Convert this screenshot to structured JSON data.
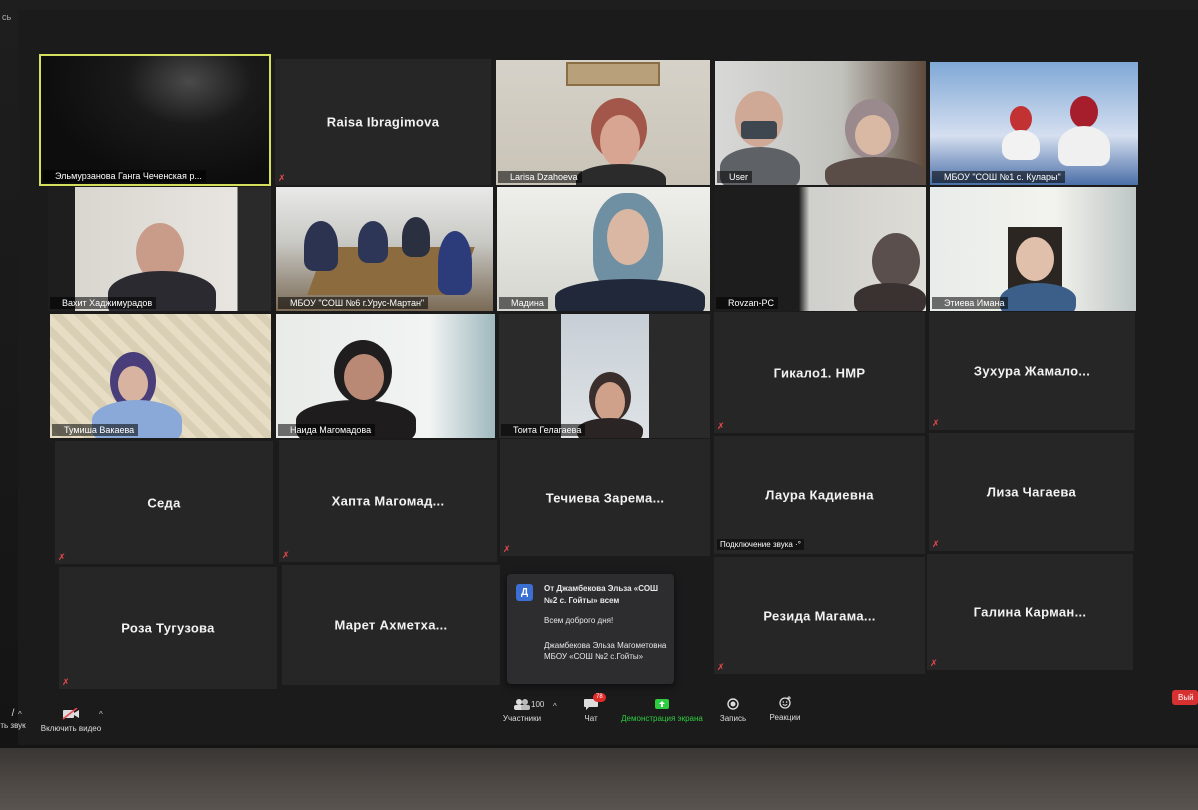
{
  "top_glyph": "сь",
  "tiles": [
    {
      "label": "Эльмурзанова Ганга Чеченская р...",
      "type": "video"
    },
    {
      "name": "Raisa Ibragimova",
      "type": "name"
    },
    {
      "label": "Larisa Dzahoeva",
      "type": "video"
    },
    {
      "label": "User",
      "type": "video"
    },
    {
      "label": "МБОУ \"СОШ №1 с. Кулары\"",
      "type": "video"
    },
    {
      "label": "Вахит Хаджимурадов",
      "type": "video"
    },
    {
      "label": "МБОУ \"СОШ №6 г.Урус-Мартан\"",
      "type": "video"
    },
    {
      "label": "Мадина",
      "type": "video"
    },
    {
      "label": "Rovzan-PC",
      "type": "video"
    },
    {
      "label": "Этиева  Имана",
      "type": "video"
    },
    {
      "label": "Тумиша Вакаева",
      "type": "video"
    },
    {
      "label": "Наида Магомадова",
      "type": "video"
    },
    {
      "label": "Тоита Гелагаева",
      "type": "video"
    },
    {
      "name": "Гикало1. НМР",
      "type": "name"
    },
    {
      "name": "Зухура  Жамало...",
      "type": "name"
    },
    {
      "name": "Седа",
      "type": "name"
    },
    {
      "name": "Хапта  Магомад...",
      "type": "name"
    },
    {
      "name": "Течиева  Зарема...",
      "type": "name"
    },
    {
      "name": "Лаура Кадиевна",
      "type": "name",
      "status": "Подключение звука ·°"
    },
    {
      "name": "Лиза Чагаева",
      "type": "name"
    },
    {
      "name": "Роза Тугузова",
      "type": "name"
    },
    {
      "name": "Марет  Ахметха...",
      "type": "name"
    },
    {
      "name": "Резида  Магама...",
      "type": "name"
    },
    {
      "name": "Галина  Карман...",
      "type": "name"
    }
  ],
  "chat_popup": {
    "avatar": "Д",
    "from": "От Джамбекова Эльза «СОШ №2 с. Гойты» всем",
    "message1": "Всем доброго дня!",
    "message2": "Джамбекова Эльза Магометовна МБОУ «СОШ №2 с.Гойты»"
  },
  "toolbar": {
    "audio_label": "ть звук",
    "video_label": "Включить видео",
    "participants_count": "100",
    "participants_label": "Участники",
    "chat_badge": "78",
    "chat_label": "Чат",
    "share_label": "Демонстрация экрана",
    "record_label": "Запись",
    "reactions_label": "Реакции",
    "leave_label": "Вый"
  },
  "colors": {
    "active_border": "#d4e05c",
    "share_green": "#2ecc40",
    "mute_red": "#e5484d",
    "leave_red": "#d63030"
  }
}
